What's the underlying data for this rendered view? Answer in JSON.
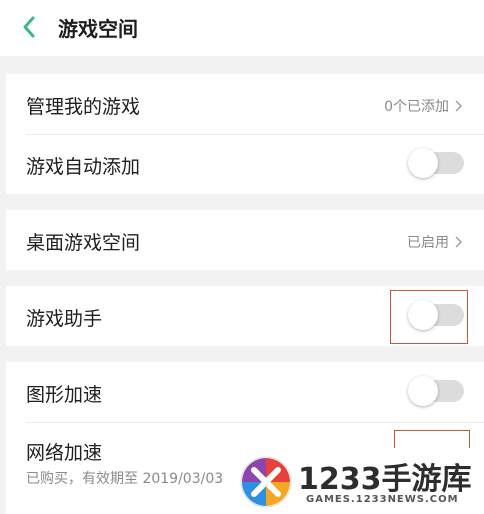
{
  "header": {
    "title": "游戏空间"
  },
  "section1": {
    "manage": {
      "label": "管理我的游戏",
      "value": "0个已添加"
    },
    "auto_add": {
      "label": "游戏自动添加"
    }
  },
  "section2": {
    "desktop": {
      "label": "桌面游戏空间",
      "value": "已启用"
    }
  },
  "section3": {
    "assistant": {
      "label": "游戏助手"
    }
  },
  "section4": {
    "graphics": {
      "label": "图形加速"
    },
    "network": {
      "label": "网络加速",
      "sub": "已购买，有效期至 2019/03/03"
    }
  },
  "watermark": {
    "title": "1233手游库",
    "url": "GAMES.1233NEWS.COM"
  },
  "colors": {
    "accent": "#3cb88a",
    "highlight": "#c8563b",
    "toggle_off": "#dcdcdc"
  }
}
